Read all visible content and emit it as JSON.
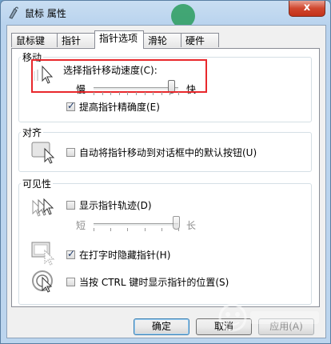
{
  "window": {
    "title": "鼠标 属性",
    "close_label": "x"
  },
  "tabs": [
    {
      "label": "鼠标键"
    },
    {
      "label": "指针"
    },
    {
      "label": "指针选项",
      "active": true
    },
    {
      "label": "滑轮"
    },
    {
      "label": "硬件"
    }
  ],
  "motion": {
    "title": "移动",
    "speed_label": "选择指针移动速度(C):",
    "slow_label": "慢",
    "fast_label": "快",
    "speed_fraction": 0.92,
    "precision_label": "提高指针精确度(E)",
    "precision_checked": true
  },
  "snap": {
    "title": "对齐",
    "label": "自动将指针移动到对话框中的默认按钮(U)",
    "checked": false
  },
  "visibility": {
    "title": "可见性",
    "trails_label": "显示指针轨迹(D)",
    "trails_checked": false,
    "short_label": "短",
    "long_label": "长",
    "trails_fraction": 0.98,
    "hide_typing_label": "在打字时隐藏指针(H)",
    "hide_typing_checked": true,
    "ctrl_label": "当按 CTRL 键时显示指针的位置(S)",
    "ctrl_checked": false
  },
  "buttons": {
    "ok": "确定",
    "cancel": "取消",
    "apply": "应用(A)"
  },
  "colors": {
    "highlight": "#e8282c",
    "accent": "#3c7fb1"
  }
}
